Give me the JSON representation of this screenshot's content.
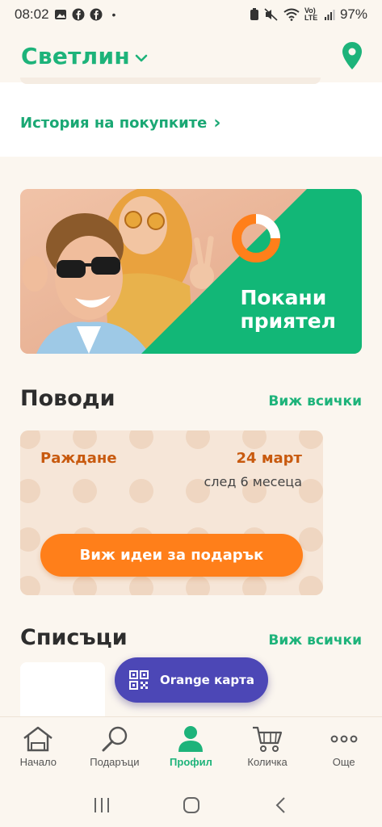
{
  "status_bar": {
    "time": "08:02",
    "dot": "•",
    "lte_label": "Vo) LTE",
    "battery": "97%"
  },
  "header": {
    "city": "Светлин",
    "icons": [
      "chevron-down-icon",
      "location-pin-icon"
    ]
  },
  "history": {
    "link_label": "История на покупките",
    "chevron": "›"
  },
  "invite_banner": {
    "title_line1": "Покани",
    "title_line2": "приятел"
  },
  "occasions": {
    "title": "Поводи",
    "see_all": "Виж всички",
    "items": [
      {
        "name": "Раждане",
        "date": "24 март",
        "relative": "след 6 месеца",
        "button_label": "Виж идеи за подарък"
      }
    ]
  },
  "lists": {
    "title": "Списъци",
    "see_all": "Виж всички"
  },
  "orange_card": {
    "label": "Orange карта"
  },
  "bottom_nav": {
    "items": [
      {
        "label": "Начало",
        "icon": "home-icon"
      },
      {
        "label": "Подаръци",
        "icon": "search-icon"
      },
      {
        "label": "Профил",
        "icon": "profile-icon",
        "active": true
      },
      {
        "label": "Количка",
        "icon": "cart-icon"
      },
      {
        "label": "Още",
        "icon": "more-icon"
      }
    ]
  },
  "colors": {
    "brand_green": "#1db37a",
    "accent_orange": "#ff7f1a",
    "card_purple": "#4c47b6",
    "background": "#fbf6ef"
  }
}
